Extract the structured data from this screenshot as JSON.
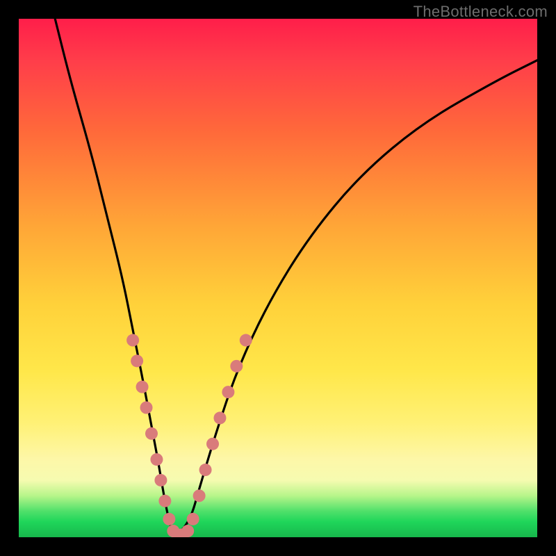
{
  "watermark": "TheBottleneck.com",
  "chart_data": {
    "type": "line",
    "title": "",
    "xlabel": "",
    "ylabel": "",
    "xlim": [
      0,
      100
    ],
    "ylim": [
      0,
      100
    ],
    "series": [
      {
        "name": "bottleneck-curve",
        "x": [
          7,
          10,
          14,
          17,
          20,
          22,
          24,
          25.5,
          27,
          28,
          29,
          30,
          33,
          35,
          38,
          42,
          48,
          56,
          66,
          78,
          92,
          100
        ],
        "y": [
          100,
          88,
          74,
          62,
          50,
          40,
          30,
          22,
          14,
          8,
          3,
          0,
          3,
          10,
          20,
          32,
          45,
          58,
          70,
          80,
          88,
          92
        ]
      }
    ],
    "markers": {
      "name": "highlight-dots",
      "color": "#d97b7b",
      "points": [
        {
          "x": 22.0,
          "y": 38
        },
        {
          "x": 22.8,
          "y": 34
        },
        {
          "x": 23.8,
          "y": 29
        },
        {
          "x": 24.6,
          "y": 25
        },
        {
          "x": 25.6,
          "y": 20
        },
        {
          "x": 26.6,
          "y": 15
        },
        {
          "x": 27.4,
          "y": 11
        },
        {
          "x": 28.2,
          "y": 7
        },
        {
          "x": 29.0,
          "y": 3.5
        },
        {
          "x": 29.8,
          "y": 1.2
        },
        {
          "x": 30.6,
          "y": 0.5
        },
        {
          "x": 31.6,
          "y": 0.5
        },
        {
          "x": 32.6,
          "y": 1.2
        },
        {
          "x": 33.6,
          "y": 3.5
        },
        {
          "x": 34.8,
          "y": 8
        },
        {
          "x": 36.0,
          "y": 13
        },
        {
          "x": 37.4,
          "y": 18
        },
        {
          "x": 38.8,
          "y": 23
        },
        {
          "x": 40.4,
          "y": 28
        },
        {
          "x": 42.0,
          "y": 33
        },
        {
          "x": 43.8,
          "y": 38
        }
      ]
    }
  }
}
